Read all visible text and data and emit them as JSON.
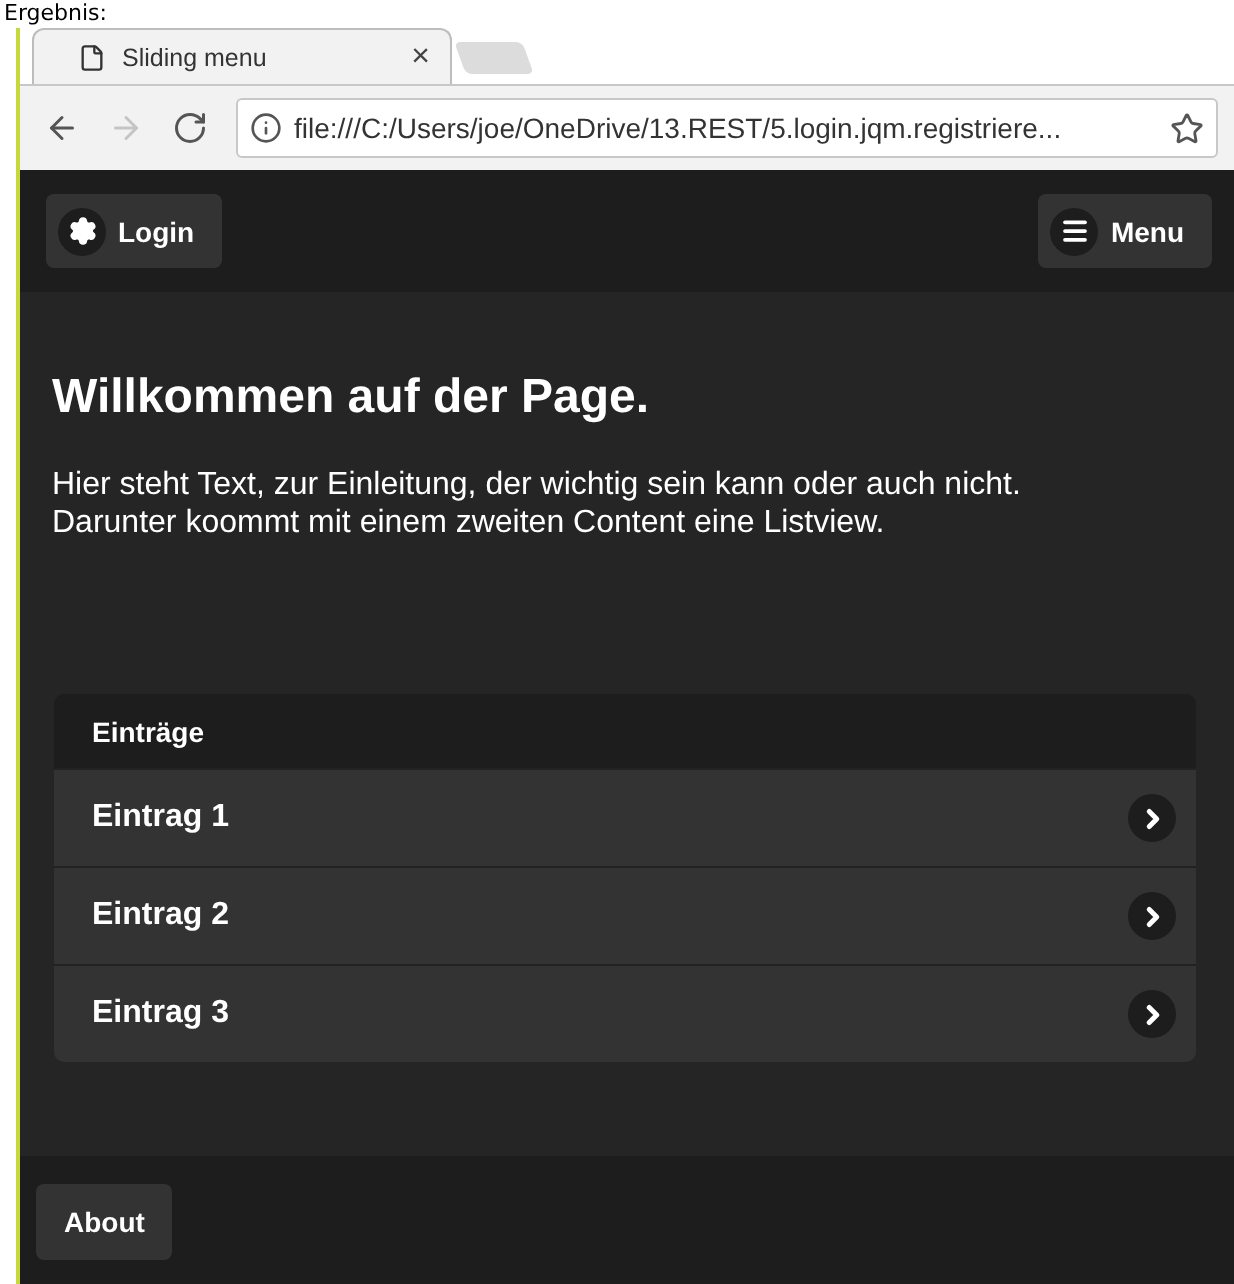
{
  "caption": "Ergebnis:",
  "browser": {
    "tab": {
      "title": "Sliding menu",
      "close": "×"
    },
    "nav": [
      {
        "kind": "back",
        "disabled": false
      },
      {
        "kind": "forward",
        "disabled": true
      },
      {
        "kind": "reload",
        "disabled": false
      }
    ],
    "address": "file:///C:/Users/joe/OneDrive/13.REST/5.login.jqm.registriere..."
  },
  "header": {
    "left_button": "Login",
    "right_button": "Menu"
  },
  "content": {
    "title": "Willkommen auf der Page.",
    "text": "Hier steht Text, zur Einleitung, der wichtig sein kann oder auch nicht. Darunter koommt mit einem zweiten Content eine Listview."
  },
  "list": {
    "divider": "Einträge",
    "items": [
      "Eintrag 1",
      "Eintrag 2",
      "Eintrag 3"
    ]
  },
  "footer": {
    "button": "About"
  }
}
